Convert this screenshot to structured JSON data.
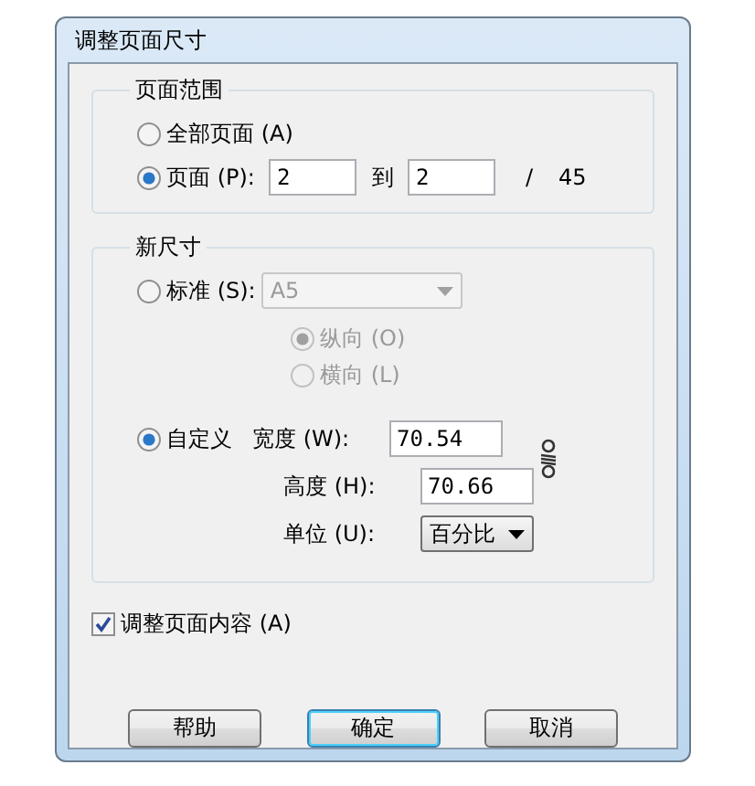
{
  "window": {
    "title": "调整页面尺寸"
  },
  "page_range": {
    "label": "页面范围",
    "options": [
      {
        "label": "全部页面 (A)",
        "selected": false
      },
      {
        "label": "页面 (P):",
        "selected": true
      }
    ],
    "from": "2",
    "to_label": "到",
    "to": "2",
    "separator": "/",
    "total": "45"
  },
  "new_size": {
    "label": "新尺寸",
    "standard": {
      "label": "标准 (S):",
      "selected": false,
      "select_value": "A5",
      "disabled": true
    },
    "orientations": [
      {
        "label": "纵向 (O)",
        "selected": true,
        "disabled": true
      },
      {
        "label": "横向 (L)",
        "selected": false,
        "disabled": true
      }
    ],
    "custom": {
      "label": "自定义",
      "selected": true
    },
    "width": {
      "label": "宽度 (W):",
      "value": "70.54"
    },
    "height": {
      "label": "高度 (H):",
      "value": "70.66"
    },
    "unit": {
      "label": "单位 (U):",
      "value": "百分比"
    }
  },
  "adjust_content": {
    "label": "调整页面内容 (A)",
    "checked": true
  },
  "buttons": [
    {
      "label": "帮助",
      "default": false
    },
    {
      "label": "确定",
      "default": true
    },
    {
      "label": "取消",
      "default": false
    }
  ]
}
